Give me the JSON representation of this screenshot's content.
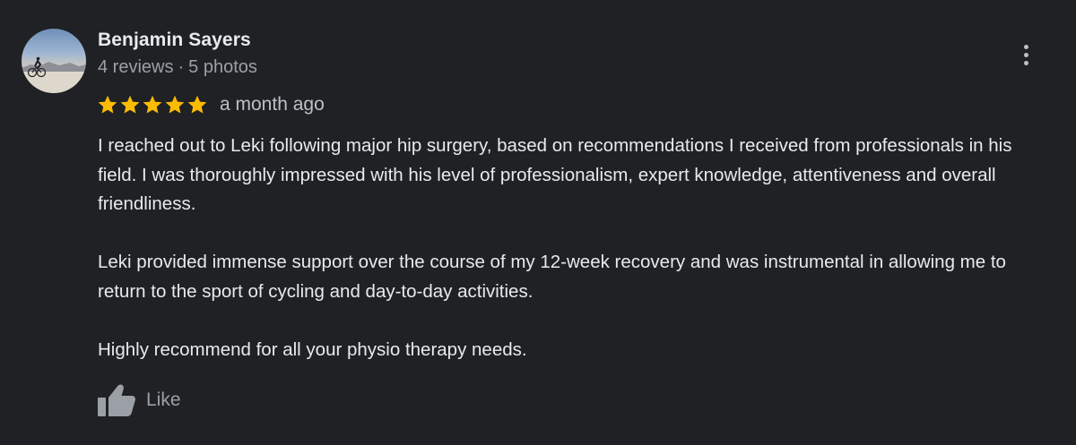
{
  "review": {
    "author": {
      "name": "Benjamin Sayers",
      "reviews": "4 reviews",
      "separator": "·",
      "photos": "5 photos"
    },
    "rating": {
      "stars": 5,
      "max": 5,
      "star_color": "#fbbc04"
    },
    "timestamp": "a month ago",
    "paragraphs": [
      "I reached out to Leki following major hip surgery, based on recommendations I received from professionals in his field. I was thoroughly impressed with his level of professionalism, expert knowledge, attentiveness and overall friendliness.",
      "Leki provided immense support over the course of my 12-week recovery and was instrumental in allowing me to return to the sport of cycling and day-to-day activities.",
      "Highly recommend for all your physio therapy needs."
    ],
    "actions": {
      "like_label": "Like",
      "like_icon": "thumb-up-icon",
      "more_icon": "more-vert-icon"
    }
  },
  "theme": {
    "background": "#202124",
    "primary_text": "#e8eaed",
    "secondary_text": "#9aa0a6"
  }
}
